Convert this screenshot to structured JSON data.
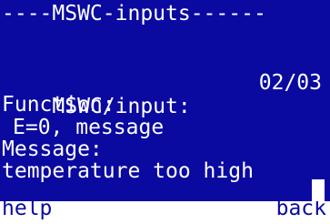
{
  "screen": {
    "header": "----MSWC-inputs------",
    "input_label": "MSWC/input:",
    "input_value": "02/03",
    "function_label": "Function:",
    "function_value": "E=0, message",
    "message_label": "Message:",
    "message_value": "temperature too high"
  },
  "softkeys": {
    "left": "help",
    "right": "back"
  },
  "colors": {
    "background": "#0a0aa0",
    "text": "#ffffff",
    "softkey_bar": "#ffffff"
  }
}
